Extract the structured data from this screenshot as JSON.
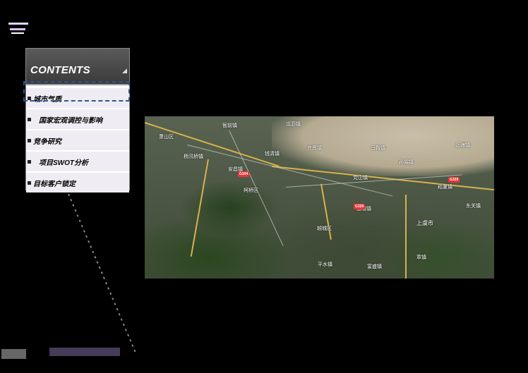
{
  "contents": {
    "title": "CONTENTS",
    "items": [
      {
        "label": "城市气质"
      },
      {
        "label": "国家宏观调控与影响"
      },
      {
        "label": "竞争研究"
      },
      {
        "label": "项目SWOT分析"
      },
      {
        "label": "目标客户锁定"
      }
    ]
  },
  "map": {
    "labels": [
      "萧山区",
      "衙前镇",
      "瓜沥镇",
      "党山镇",
      "杨汛桥镇",
      "钱清镇",
      "柯桥区",
      "越城区",
      "上虞市",
      "道墟镇",
      "沥海镇",
      "崧厦镇",
      "东关镇",
      "孙端镇",
      "安昌镇",
      "马鞍镇",
      "齐贤镇",
      "平水镇",
      "富盛镇",
      "章镇"
    ],
    "shields": [
      "G104",
      "G329",
      "G329"
    ]
  },
  "colors": {
    "selection": "#2f5597",
    "header": "#4a4a4a",
    "item_bg": "#efedf3"
  }
}
